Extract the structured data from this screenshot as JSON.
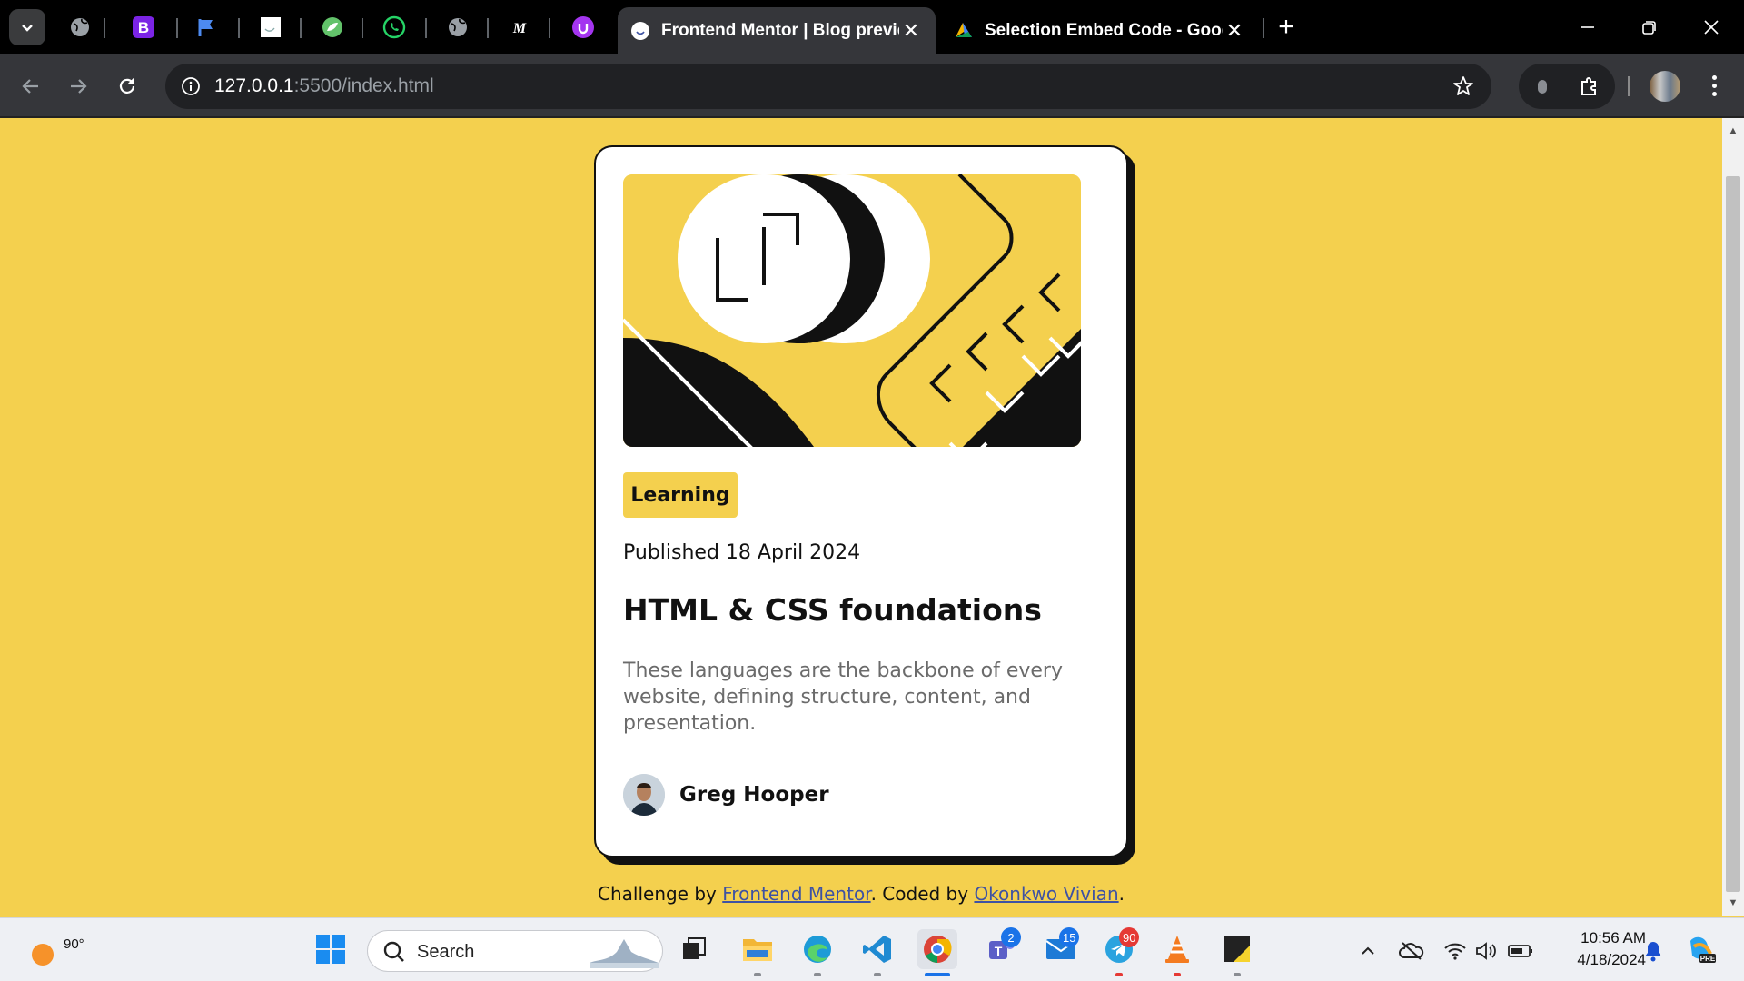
{
  "browser": {
    "tabs": [
      {
        "title": "Frontend Mentor | Blog preview card",
        "active": true
      },
      {
        "title": "Selection Embed Code - Google",
        "active": false
      }
    ],
    "url_host": "127.0.0.1",
    "url_path": ":5500/index.html",
    "colors": {
      "chrome": "#35363a",
      "tabbar": "#000000"
    }
  },
  "card": {
    "tag": "Learning",
    "published": "Published 18 April 2024",
    "title": "HTML & CSS foundations",
    "description": "These languages are the backbone of every website, defining structure, content, and presentation.",
    "author": "Greg Hooper",
    "accent": "#f4d04e"
  },
  "footer": {
    "prefix": "Challenge by ",
    "link1": "Frontend Mentor",
    "middle": ". Coded by ",
    "link2": "Okonkwo Vivian",
    "suffix": "."
  },
  "taskbar": {
    "weather_temp": "90°",
    "search_placeholder": "Search",
    "time": "10:56 AM",
    "date": "4/18/2024",
    "badges": {
      "teams": "2",
      "mail": "15",
      "telegram": "90"
    }
  }
}
